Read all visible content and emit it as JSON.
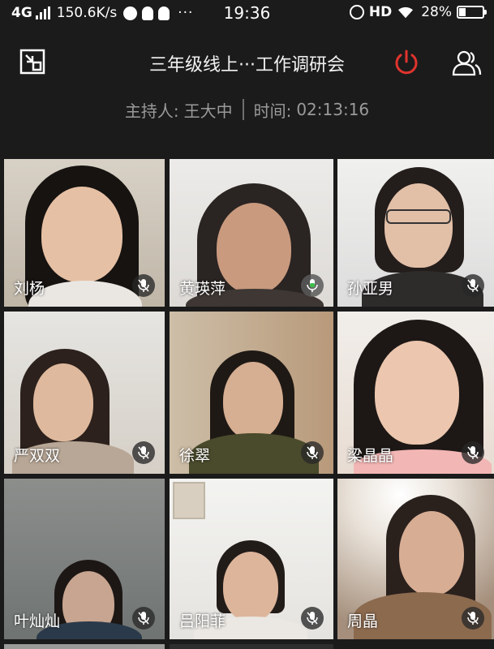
{
  "status_bar": {
    "network": "4G",
    "rate": "150.6K/s",
    "more": "···",
    "time": "19:36",
    "hd": "HD",
    "battery": "28%",
    "battery_level": 0.28
  },
  "header": {
    "title": "三年级线上···工作调研会",
    "host_label": "主持人:",
    "host_name": "王大中",
    "time_label": "时间:",
    "elapsed": "02:13:16",
    "colors": {
      "end_button": "#e0342e",
      "background": "#1b1b1b"
    }
  },
  "icons": {
    "exit_fullscreen": "exit-fullscreen-icon",
    "end_meeting": "power-icon",
    "members": "members-icon",
    "muted_mic": "mic-muted-icon"
  },
  "participants": [
    {
      "name": "刘杨",
      "muted": true,
      "speaking": false
    },
    {
      "name": "黄瑛萍",
      "muted": false,
      "speaking": true
    },
    {
      "name": "孙亚男",
      "muted": true,
      "speaking": false
    },
    {
      "name": "严双双",
      "muted": true,
      "speaking": false
    },
    {
      "name": "徐翠",
      "muted": true,
      "speaking": false
    },
    {
      "name": "梁晶晶",
      "muted": true,
      "speaking": false
    },
    {
      "name": "叶灿灿",
      "muted": true,
      "speaking": false
    },
    {
      "name": "吕阳菲",
      "muted": true,
      "speaking": false
    },
    {
      "name": "周晶",
      "muted": true,
      "speaking": false
    }
  ]
}
